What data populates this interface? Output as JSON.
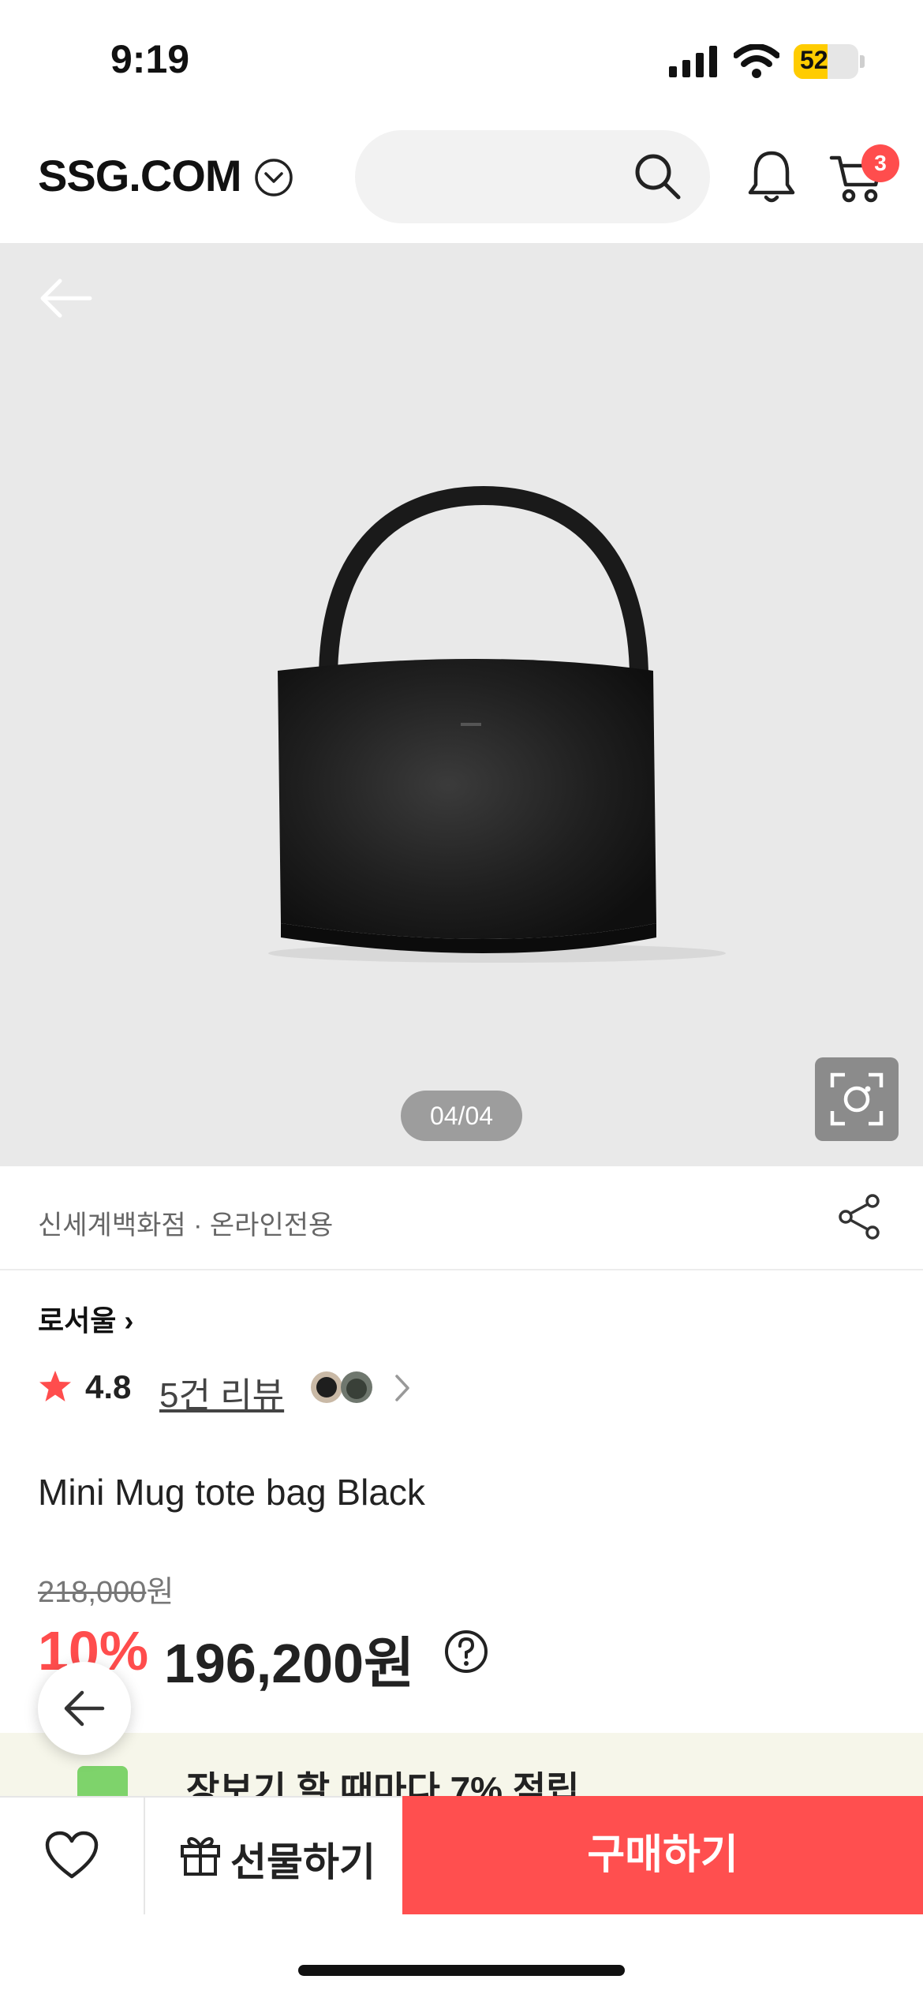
{
  "status_bar": {
    "time": "9:19",
    "battery_percent": "52",
    "battery_level": 0.52
  },
  "header": {
    "logo": "SSG.COM",
    "search_placeholder": "",
    "cart_count": "3"
  },
  "product": {
    "image_counter": "04/04",
    "seller_info": "신세계백화점 · 온라인전용",
    "brand": "로서울",
    "rating": "4.8",
    "review_link": "5건 리뷰",
    "title": "Mini Mug tote bag Black",
    "original_price": "218,000",
    "original_price_unit": "원",
    "discount_rate": "10%",
    "sale_price": "196,200원"
  },
  "promo": {
    "text": "장보기 할 때마다 7% 적립"
  },
  "actions": {
    "gift_label": "선물하기",
    "buy_label": "구매하기"
  },
  "colors": {
    "accent": "#ff4d4d",
    "buy_button": "#ff4f4f",
    "image_bg": "#e9e9e9"
  },
  "icons": [
    "chevron-down-icon",
    "search-icon",
    "bell-icon",
    "cart-icon",
    "back-arrow-icon",
    "lens-icon",
    "share-icon",
    "star-icon",
    "chevron-right-icon",
    "help-icon",
    "heart-icon",
    "gift-icon"
  ]
}
